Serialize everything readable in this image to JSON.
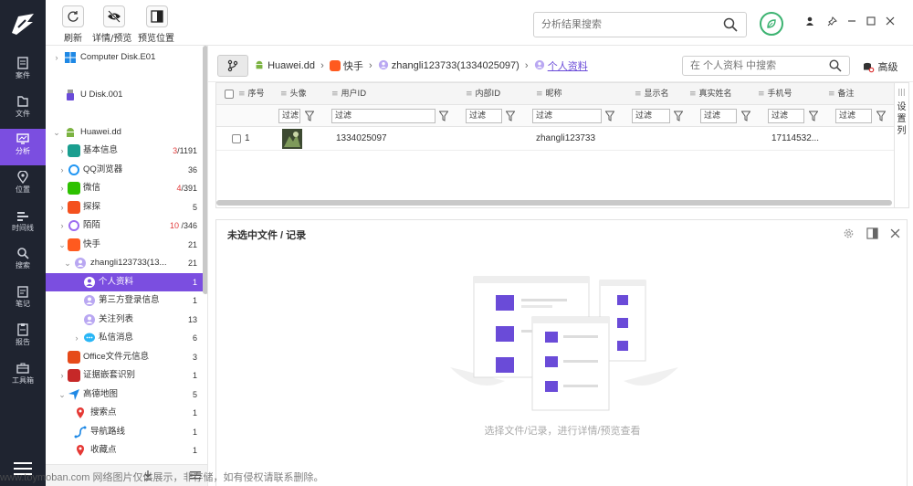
{
  "rail": {
    "items": [
      {
        "label": "案件",
        "icon": "case-icon"
      },
      {
        "label": "文件",
        "icon": "file-icon"
      },
      {
        "label": "分析",
        "icon": "analysis-icon"
      },
      {
        "label": "位置",
        "icon": "location-icon"
      },
      {
        "label": "时间线",
        "icon": "timeline-icon"
      },
      {
        "label": "搜索",
        "icon": "search-icon"
      },
      {
        "label": "笔记",
        "icon": "note-icon"
      },
      {
        "label": "报告",
        "icon": "report-icon"
      },
      {
        "label": "工具箱",
        "icon": "toolbox-icon"
      }
    ]
  },
  "toolbar": {
    "refresh": "刷新",
    "details": "详情/预览",
    "preview_pos": "预览位置",
    "search_placeholder": "分析结果搜索"
  },
  "tree": {
    "nodes": [
      {
        "label": "Computer Disk.E01"
      },
      {
        "label": "U Disk.001"
      },
      {
        "label": "Huawei.dd"
      },
      {
        "label": "基本信息",
        "count_red": "3",
        "count": "/1191"
      },
      {
        "label": "QQ浏览器",
        "count": "36"
      },
      {
        "label": "微信",
        "count_red": "4",
        "count": "/391"
      },
      {
        "label": "探探",
        "count": "5"
      },
      {
        "label": "陌陌",
        "count_red": "10",
        "count": " /346"
      },
      {
        "label": "快手",
        "count": "21"
      },
      {
        "label": "zhangli123733(13...",
        "count": "21"
      },
      {
        "label": "个人资料",
        "count": "1"
      },
      {
        "label": "第三方登录信息",
        "count": "1"
      },
      {
        "label": "关注列表",
        "count": "13"
      },
      {
        "label": "私信消息",
        "count": "6"
      },
      {
        "label": "Office文件元信息",
        "count": "3"
      },
      {
        "label": "证据嵌套识别",
        "count": "1"
      },
      {
        "label": "高德地图",
        "count": "5"
      },
      {
        "label": "搜索点",
        "count": "1"
      },
      {
        "label": "导航路线",
        "count": "1"
      },
      {
        "label": "收藏点",
        "count": "1"
      }
    ]
  },
  "breadcrumb": {
    "device": "Huawei.dd",
    "app": "快手",
    "account": "zhangli123733(1334025097)",
    "current": "个人资料",
    "search_placeholder": "在 个人资料 中搜索",
    "advanced": "高级"
  },
  "grid": {
    "columns": [
      "序号",
      "头像",
      "用户ID",
      "内部ID",
      "昵称",
      "显示名",
      "真实姓名",
      "手机号",
      "备注"
    ],
    "filter_label": "过滤",
    "rows": [
      {
        "index": "1",
        "user_id": "1334025097",
        "nickname": "zhangli123733",
        "phone": "17114532..."
      }
    ],
    "column_settings": "设置列"
  },
  "detail": {
    "title": "未选中文件 / 记录",
    "empty": "选择文件/记录，进行详情/预览查看"
  },
  "watermark": "www.toymoban.com 网络图片仅供展示，非存储，如有侵权请联系删除。"
}
